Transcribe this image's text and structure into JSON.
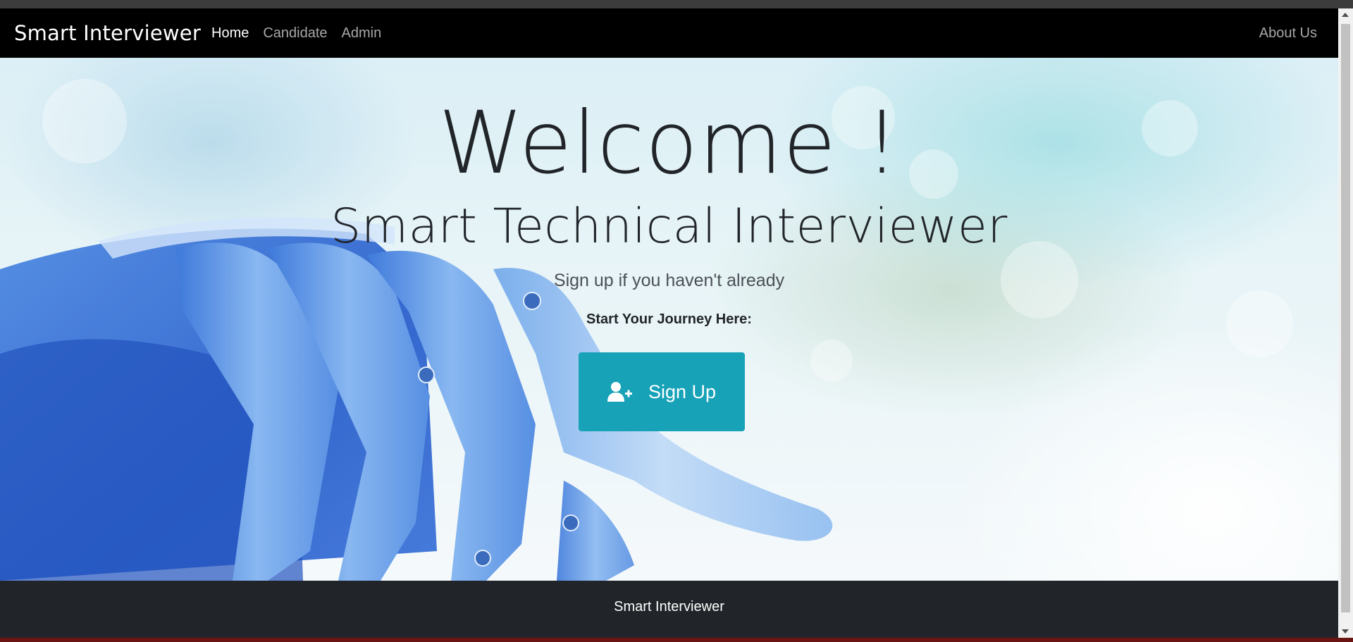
{
  "navbar": {
    "brand": "Smart Interviewer",
    "links": [
      {
        "label": "Home",
        "active": true
      },
      {
        "label": "Candidate",
        "active": false
      },
      {
        "label": "Admin",
        "active": false
      }
    ],
    "right_link": "About Us"
  },
  "hero": {
    "welcome": "Welcome !",
    "subtitle": "Smart Technical Interviewer",
    "prompt": "Sign up if you haven't already",
    "journey": "Start Your Journey Here:",
    "signup_button": {
      "label": "Sign Up",
      "icon": "user-plus-icon",
      "color": "#17a2b8"
    }
  },
  "footer": {
    "text": "Smart Interviewer"
  },
  "colors": {
    "navbar_bg": "#000000",
    "footer_bg": "#212529",
    "button_bg": "#17a2b8"
  }
}
